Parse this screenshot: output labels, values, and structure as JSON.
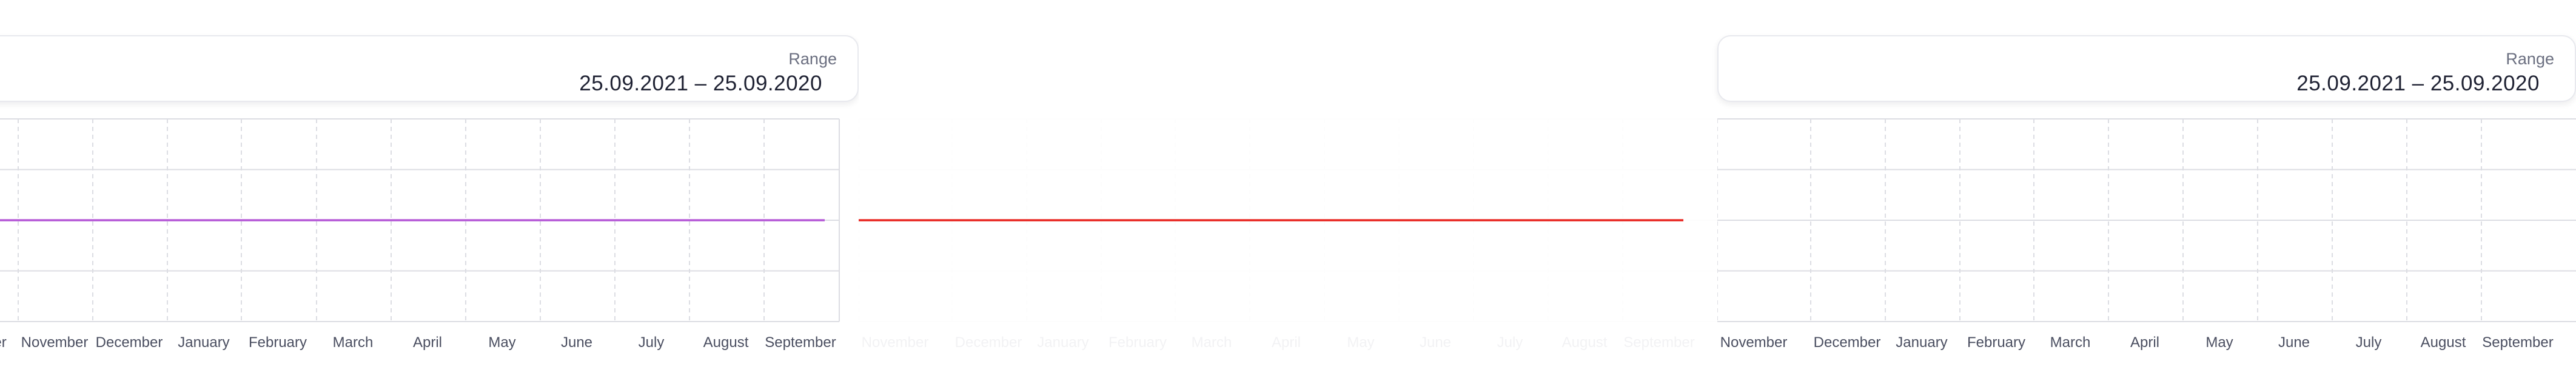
{
  "range": {
    "label": "Range",
    "value": "25.09.2021 – 25.09.2020"
  },
  "colors": {
    "grid": "#dcdde3",
    "tick_text": "#4a4e60",
    "series_left": "#b455d6",
    "series_center": "#e8231f",
    "series_right": "#e8e8ec"
  },
  "chart_data": [
    {
      "type": "line",
      "x": [
        "October",
        "November",
        "December",
        "January",
        "February",
        "March",
        "April",
        "May",
        "June",
        "July",
        "August",
        "September"
      ],
      "series": [
        {
          "values": [
            0,
            0,
            0,
            0,
            0,
            0,
            0,
            0,
            0,
            0,
            0,
            0
          ],
          "color": "#b455d6"
        }
      ],
      "ylim": [
        -2,
        2
      ],
      "grid": true,
      "visible_ticks": [
        "November",
        "December",
        "January",
        "February",
        "March",
        "April",
        "May",
        "June",
        "July",
        "August",
        "September"
      ]
    },
    {
      "type": "line",
      "x": [
        "November",
        "December",
        "January",
        "February",
        "March",
        "April",
        "May",
        "June",
        "July",
        "August",
        "September"
      ],
      "series": [
        {
          "values": [
            0,
            0,
            0,
            0,
            0,
            0,
            0,
            0,
            0,
            0,
            0
          ],
          "color": "#e8231f"
        }
      ],
      "ylim": [
        -2,
        2
      ],
      "grid": true,
      "faded": true
    },
    {
      "type": "line",
      "x": [
        "November",
        "December",
        "January",
        "February",
        "March",
        "April",
        "May",
        "June",
        "July",
        "August",
        "September"
      ],
      "series": [],
      "ylim": [
        -2,
        2
      ],
      "grid": true
    }
  ]
}
